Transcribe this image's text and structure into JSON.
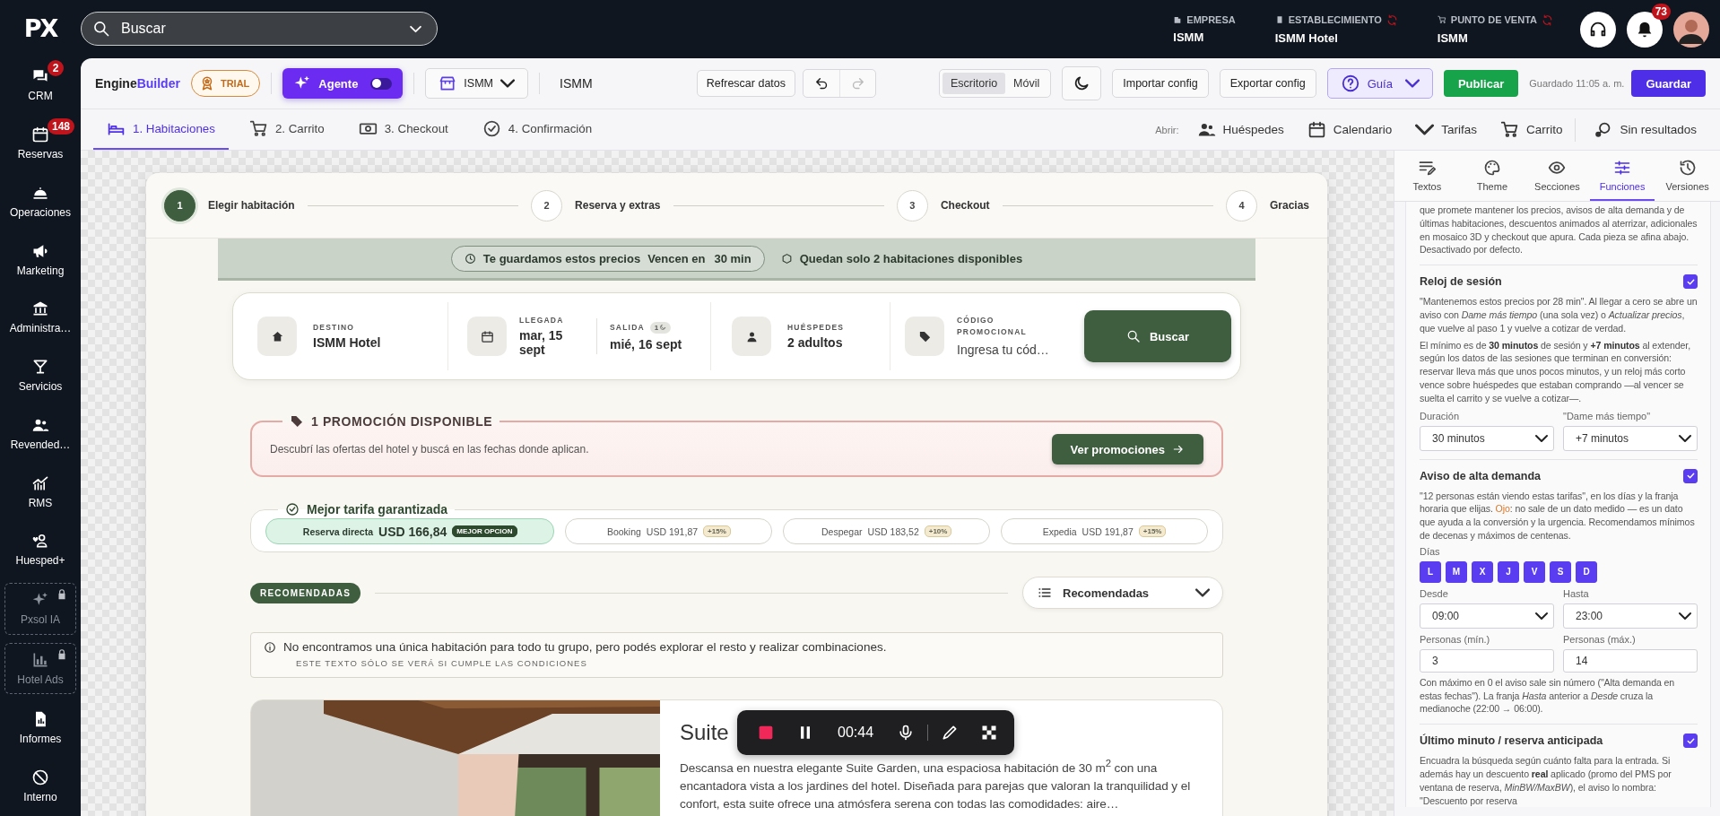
{
  "topbar": {
    "logo": "PX",
    "search": {
      "placeholder": "Buscar"
    },
    "context": [
      {
        "label": "EMPRESA",
        "value": "ISMM",
        "sync": false
      },
      {
        "label": "ESTABLECIMIENTO",
        "value": "ISMM Hotel",
        "sync": true
      },
      {
        "label": "PUNTO DE VENTA",
        "value": "ISMM",
        "sync": true
      }
    ],
    "notifications": "73"
  },
  "sidebar": {
    "items": [
      {
        "label": "CRM",
        "badge": "2",
        "locked": false
      },
      {
        "label": "Reservas",
        "badge": "148",
        "locked": false
      },
      {
        "label": "Operaciones",
        "locked": false
      },
      {
        "label": "Marketing",
        "locked": false
      },
      {
        "label": "Administra…",
        "locked": false
      },
      {
        "label": "Servicios",
        "locked": false
      },
      {
        "label": "Revended…",
        "locked": false
      },
      {
        "label": "RMS",
        "locked": false
      },
      {
        "label": "Huesped+",
        "locked": false
      },
      {
        "label": "Pxsol IA",
        "locked": true
      },
      {
        "label": "Hotel Ads",
        "locked": true
      },
      {
        "label": "Informes",
        "locked": false
      },
      {
        "label": "Interno",
        "locked": false
      }
    ]
  },
  "toolbar": {
    "brand": [
      "Engine",
      "Builder"
    ],
    "plan": "TRIAL",
    "agent": {
      "label": "Agente",
      "on": false
    },
    "property": "ISMM",
    "property_name": "ISMM",
    "refresh": "Refrescar datos",
    "undo": {
      "disabled": false
    },
    "redo": {
      "disabled": true
    },
    "views": [
      {
        "label": "Escritorio",
        "selected": true
      },
      {
        "label": "Móvil",
        "selected": false
      }
    ],
    "import": "Importar config",
    "export": "Exportar config",
    "guide": "Guía",
    "publish": "Publicar",
    "saved": "Guardado 11:05 a. m.",
    "save": "Guardar"
  },
  "steps_nav": {
    "tabs": [
      {
        "label": "1. Habitaciones",
        "selected": true
      },
      {
        "label": "2. Carrito",
        "selected": false
      },
      {
        "label": "3. Checkout",
        "selected": false
      },
      {
        "label": "4. Confirmación",
        "selected": false
      }
    ],
    "open_label": "Abrir:",
    "open_links": [
      {
        "label": "Huéspedes"
      },
      {
        "label": "Calendario"
      },
      {
        "label": "Tarifas"
      },
      {
        "label": "Carrito"
      },
      {
        "label": "Sin resultados"
      }
    ]
  },
  "preview": {
    "stepper": [
      {
        "number": "1",
        "label": "Elegir habitación",
        "selected": true
      },
      {
        "number": "2",
        "label": "Reserva y extras",
        "selected": false
      },
      {
        "number": "3",
        "label": "Checkout",
        "selected": false
      },
      {
        "number": "4",
        "label": "Gracias",
        "selected": false
      }
    ],
    "urgency": {
      "hold": "Te guardamos estos precios",
      "expires": "Vencen en",
      "time": "30 min",
      "stock": "Quedan solo 2 habitaciones disponibles"
    },
    "search": {
      "destination": {
        "label": "DESTINO",
        "value": "ISMM Hotel"
      },
      "checkin": {
        "label": "LLEGADA",
        "value": "mar, 15 sept"
      },
      "checkout": {
        "label": "SALIDA",
        "value": "mié, 16 sept",
        "nights": "1"
      },
      "guests": {
        "label": "HUÉSPEDES",
        "value": "2 adultos"
      },
      "promo_code": {
        "label": "CÓDIGO PROMOCIONAL",
        "placeholder": "Ingresa tu cód…"
      },
      "button": "Buscar"
    },
    "promotion": {
      "title": "1 PROMOCIÓN DISPONIBLE",
      "text": "Descubrí las ofertas del hotel y buscá en las fechas donde aplican.",
      "button": "Ver promociones"
    },
    "best_rate": {
      "title": "Mejor tarifa garantizada",
      "rates": [
        {
          "channel": "Reserva directa",
          "price": "USD 166,84",
          "tag": "MEJOR OPCION",
          "selected": true
        },
        {
          "channel": "Booking",
          "price": "USD 191,87",
          "tag": "+15%",
          "selected": false
        },
        {
          "channel": "Despegar",
          "price": "USD 183,52",
          "tag": "+10%",
          "selected": false
        },
        {
          "channel": "Expedia",
          "price": "USD 191,87",
          "tag": "+15%",
          "selected": false
        }
      ]
    },
    "list_header": {
      "tag": "RECOMENDADAS",
      "sort": "Recomendadas"
    },
    "notice": {
      "text": "No encontramos una única habitación para todo tu grupo, pero podés explorar el resto y realizar combinaciones.",
      "condition": "ESTE TEXTO SÓLO SE VERÁ SI CUMPLE LAS CONDICIONES"
    },
    "room": {
      "name": "Suite",
      "description": "Descansa en nuestra elegante Suite Garden, una espaciosa habitación de 30 m$^{2}$ con una encantadora vista a los jardines del hotel. Diseñada para parejas que valoran la tranquilidad y el confort, esta suite ofrece una atmósfera serena con todas las comodidades: aire…"
    }
  },
  "recorder": {
    "time": "00:44"
  },
  "panel": {
    "tabs": [
      {
        "label": "Textos",
        "selected": false
      },
      {
        "label": "Theme",
        "selected": false
      },
      {
        "label": "Secciones",
        "selected": false
      },
      {
        "label": "Funciones",
        "selected": true
      },
      {
        "label": "Versiones",
        "selected": false
      }
    ],
    "intro": "que promete mantener los precios, avisos de alta demanda y de últimas habitaciones, descuentos animados al aterrizar, adicionales en mosaico 3D y checkout que apura. Cada pieza se afina abajo. Desactivado por defecto.",
    "features": [
      {
        "title": "Reloj de sesión",
        "checked": true,
        "blocks": [
          {
            "kind": "text",
            "text": "\"Mantenemos estos precios por 28 min\". Al llegar a cero se abre un aviso con *Dame más tiempo* (una sola vez) o *Actualizar precios*, que vuelve al paso 1 y vuelve a cotizar de verdad."
          },
          {
            "kind": "text",
            "text": "El mínimo es de **30 minutos** de sesión y **+7 minutos** al extender, según los datos de las sesiones que terminan en conversión: reservar lleva más que unos pocos minutos, y un reloj más corto vence sobre huéspedes que estaban comprando —al vencer se suelta el carrito y se vuelve a cotizar—."
          },
          {
            "kind": "fields",
            "fields": [
              {
                "kind": "select",
                "label": "Duración",
                "value": "30 minutos"
              },
              {
                "kind": "select",
                "label": "\"Dame más tiempo\"",
                "value": "+7 minutos"
              }
            ]
          }
        ]
      },
      {
        "title": "Aviso de alta demanda",
        "checked": true,
        "blocks": [
          {
            "kind": "text",
            "text": "\"12 personas están viendo estas tarifas\", en los días y la franja horaria que elijas. **Ojo**: no sale de un dato medido — es un dato que ayuda a la conversión y la urgencia. Recomendamos mínimos de decenas y máximos de centenas.",
            "accent": true
          },
          {
            "kind": "days",
            "label": "Días",
            "days": [
              {
                "label": "L",
                "selected": true
              },
              {
                "label": "M",
                "selected": true
              },
              {
                "label": "X",
                "selected": true
              },
              {
                "label": "J",
                "selected": true
              },
              {
                "label": "V",
                "selected": true
              },
              {
                "label": "S",
                "selected": true
              },
              {
                "label": "D",
                "selected": true
              }
            ]
          },
          {
            "kind": "fields",
            "fields": [
              {
                "kind": "select",
                "label": "Desde",
                "value": "09:00"
              },
              {
                "kind": "select",
                "label": "Hasta",
                "value": "23:00"
              }
            ]
          },
          {
            "kind": "fields",
            "fields": [
              {
                "kind": "input",
                "label": "Personas (mín.)",
                "value": "3"
              },
              {
                "kind": "input",
                "label": "Personas (máx.)",
                "value": "14"
              }
            ]
          },
          {
            "kind": "text",
            "text": "Con máximo en 0 el aviso sale sin número (\"Alta demanda en estas fechas\"). La franja *Hasta* anterior a *Desde* cruza la medianoche (22:00 → 06:00)."
          }
        ]
      },
      {
        "title": "Último minuto / reserva anticipada",
        "checked": true,
        "blocks": [
          {
            "kind": "text",
            "text": "Encuadra la búsqueda según cuánto falta para la entrada. Si además hay un descuento **real** aplicado (promo del PMS por ventana de reserva, *MinBW/MaxBW*), el aviso lo nombra: \"Descuento por reserva"
          }
        ]
      }
    ]
  }
}
